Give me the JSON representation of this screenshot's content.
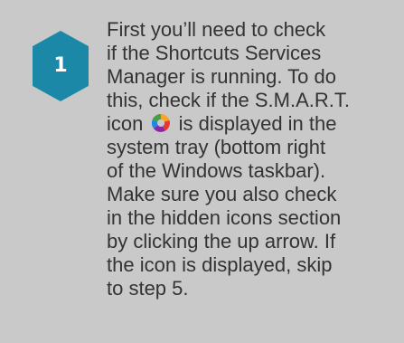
{
  "step": {
    "number": "1",
    "lines": [
      "First you’ll need to check",
      "if the Shortcuts Services",
      "Manager is running. To do",
      "this, check if the S.M.A.R.T.",
      "is displayed in the",
      "system tray (bottom right",
      "of the Windows taskbar).",
      "Make sure you also check",
      "in the hidden icons section",
      "by clicking the up arrow. If",
      "the icon is displayed, skip",
      "to step 5."
    ],
    "icon_line_prefix": "icon",
    "icon": "smart-app-icon"
  },
  "colors": {
    "card_background": "#c9c9c9",
    "badge": "#1a88a6",
    "text": "#333333"
  }
}
